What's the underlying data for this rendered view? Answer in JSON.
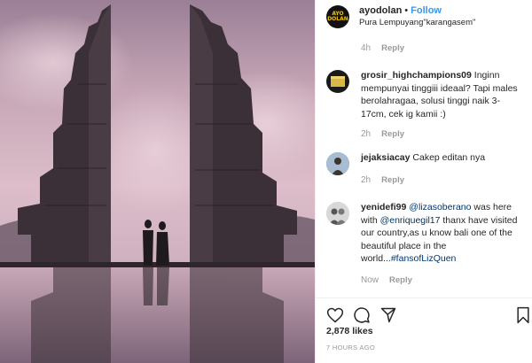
{
  "header": {
    "username": "ayodolan",
    "separator": "•",
    "follow_label": "Follow",
    "location": "Pura Lempuyang\"karangasem\"",
    "avatar_logo_text": "AYO DOLAN"
  },
  "caption_time": {
    "time": "4h",
    "reply_label": "Reply"
  },
  "comments": [
    {
      "username": "grosir_highchampions09",
      "text": "Inginn mempunyai tinggiii ideaal? Tapi males berolahragaa, solusi tinggi naik 3-17cm, cek ig kamii :)",
      "time": "2h",
      "reply_label": "Reply"
    },
    {
      "username": "jejaksiacay",
      "text": "Cakep editan nya",
      "time": "2h",
      "reply_label": "Reply"
    },
    {
      "username": "yenidefi99",
      "text_parts": [
        "@lizasoberano",
        " was here with ",
        "@enriquegil17",
        " thanx have visited our country,as u know bali one of the beautiful place in the world...",
        "#fansofLizQuen"
      ],
      "time": "Now",
      "reply_label": "Reply"
    }
  ],
  "actions": {
    "icons": [
      "heart-icon",
      "comment-icon",
      "share-icon",
      "bookmark-icon"
    ],
    "likes": "2,878 likes",
    "posted_ago": "7 HOURS AGO"
  },
  "colors": {
    "link": "#3897f0",
    "mention": "#003569",
    "muted": "#999999",
    "text": "#262626"
  }
}
